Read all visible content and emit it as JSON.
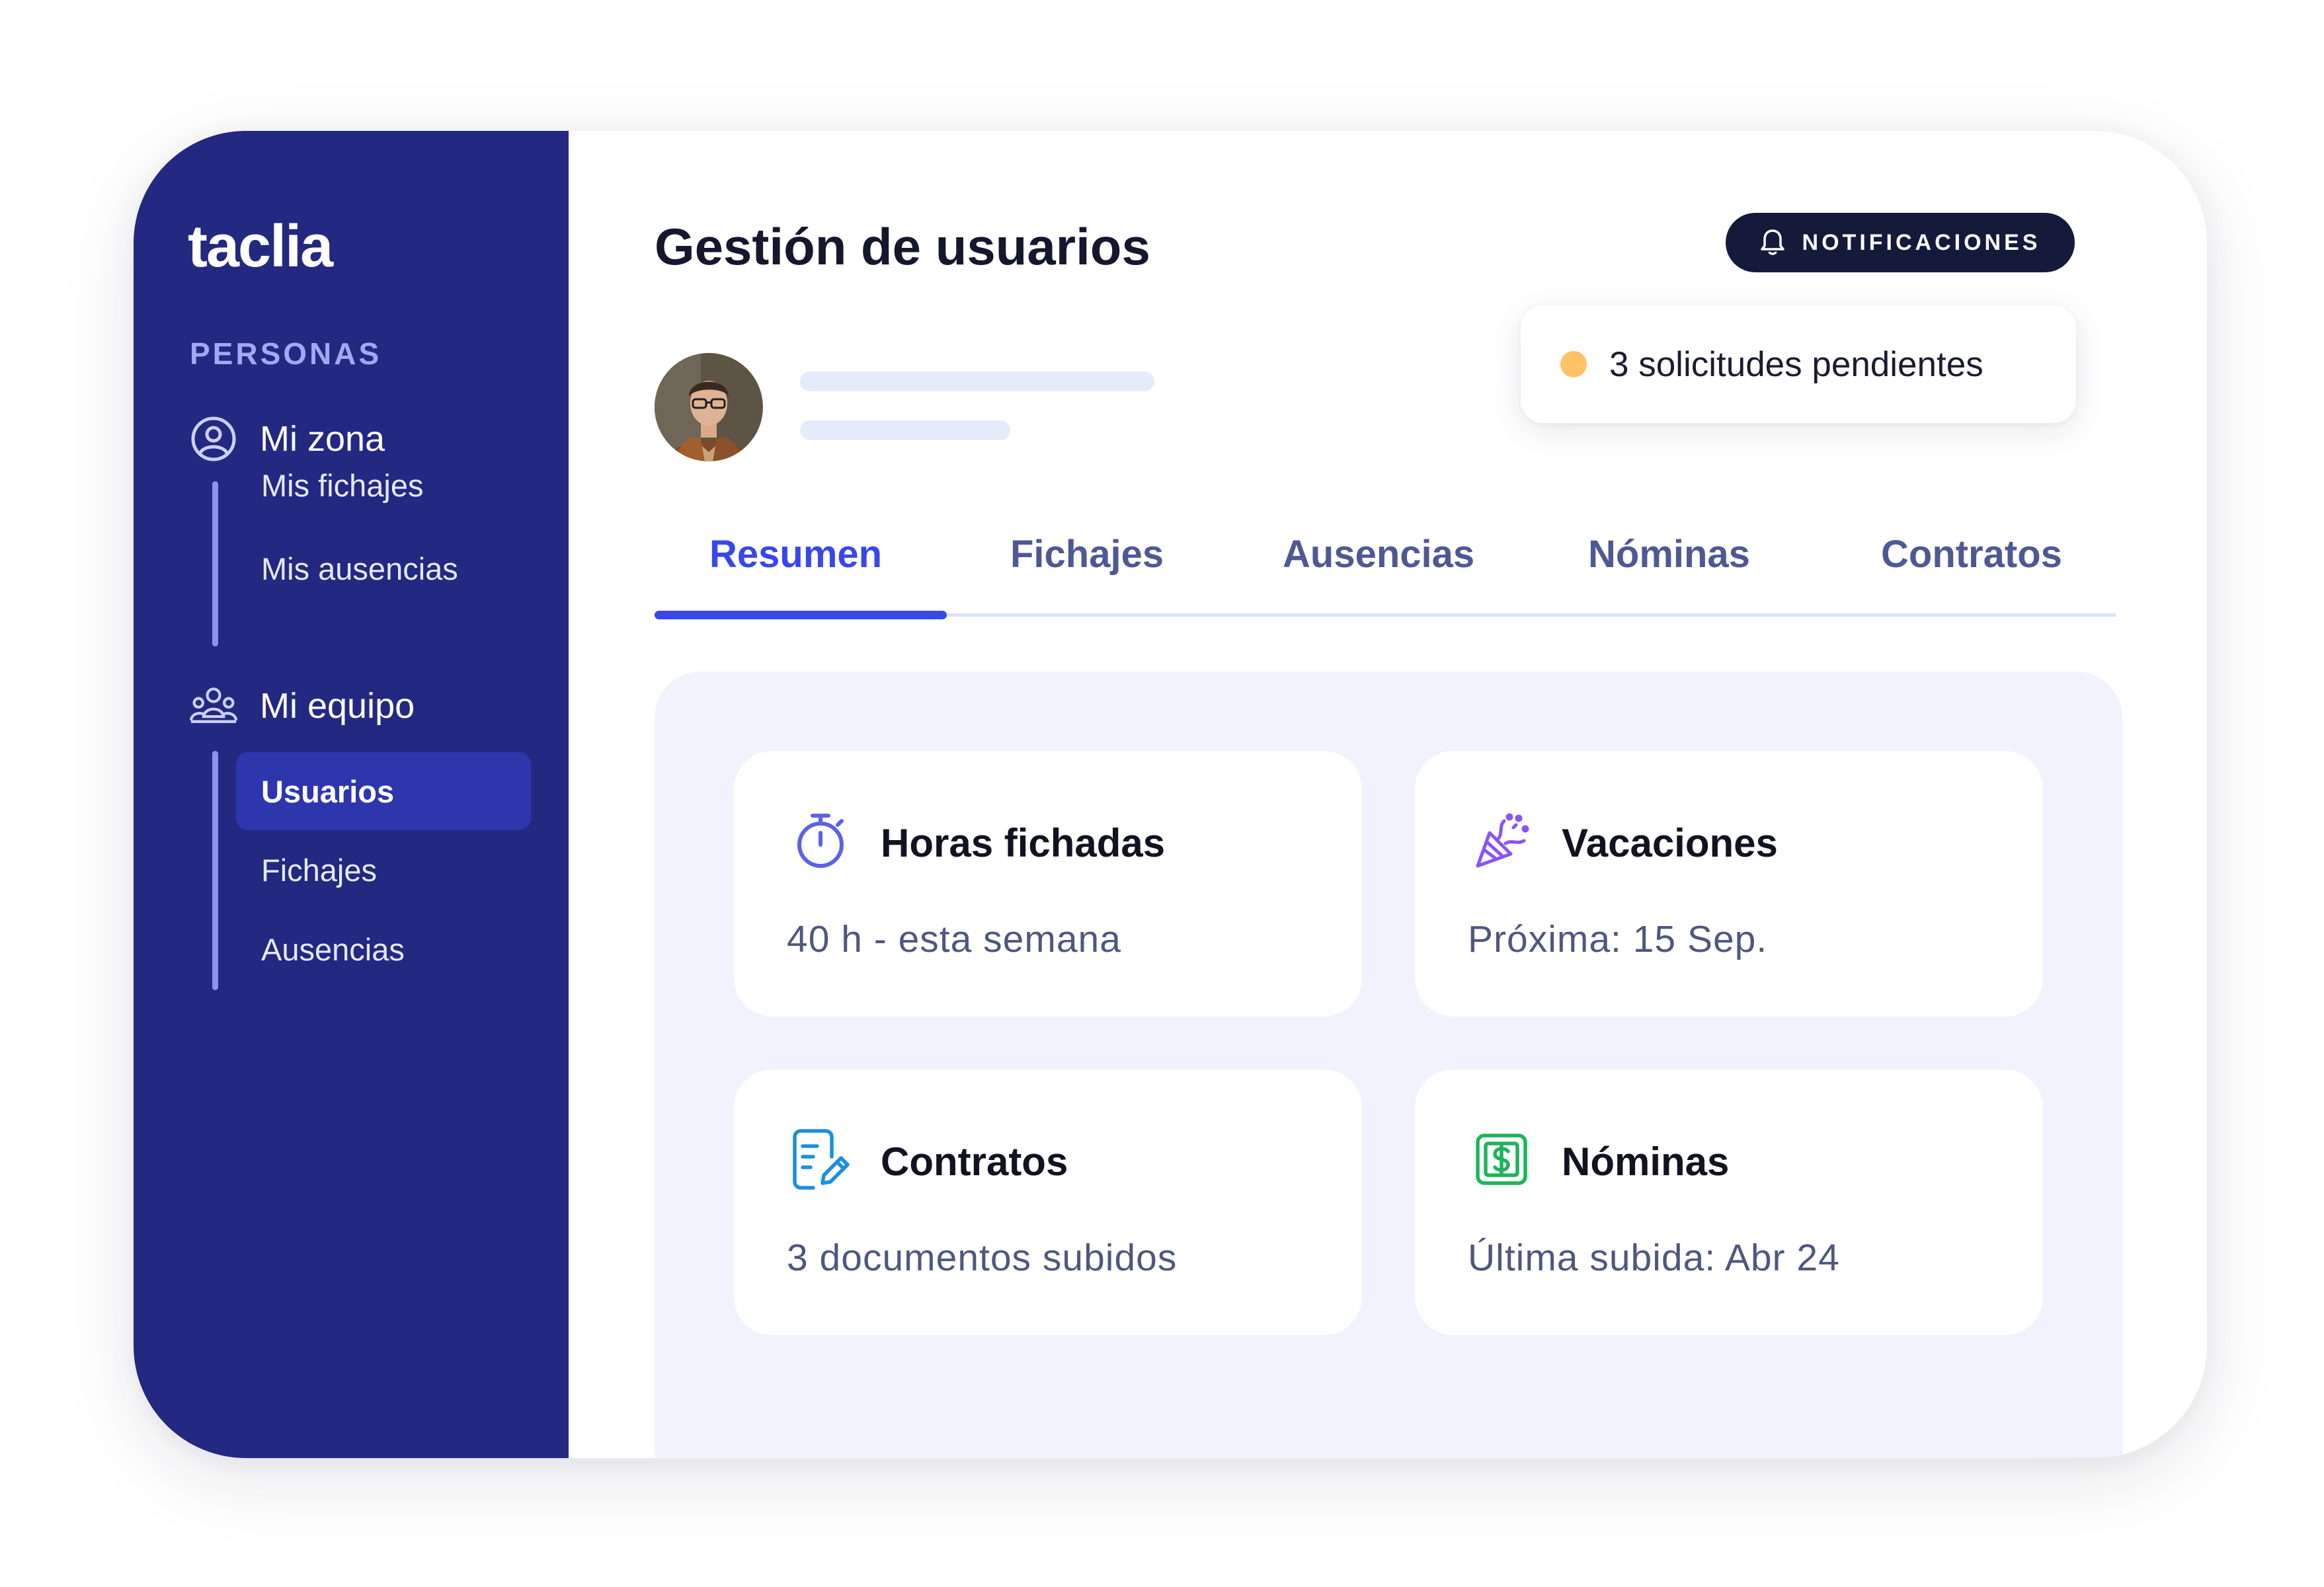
{
  "app": {
    "logo": "taclia",
    "page_title": "Gestión de usuarios"
  },
  "sidebar": {
    "section_label": "PERSONAS",
    "groups": [
      {
        "label": "Mi zona",
        "icon": "user-circle-icon",
        "items": [
          {
            "label": "Mis fichajes",
            "active": false
          },
          {
            "label": "Mis ausencias",
            "active": false
          }
        ]
      },
      {
        "label": "Mi equipo",
        "icon": "team-icon",
        "items": [
          {
            "label": "Usuarios",
            "active": true
          },
          {
            "label": "Fichajes",
            "active": false
          },
          {
            "label": "Ausencias",
            "active": false
          }
        ]
      }
    ]
  },
  "header": {
    "notifications_label": "NOTIFICACIONES",
    "pending_text": "3 solicitudes pendientes",
    "pending_dot_color": "#ffc266"
  },
  "tabs": [
    {
      "label": "Resumen",
      "active": true
    },
    {
      "label": "Fichajes",
      "active": false
    },
    {
      "label": "Ausencias",
      "active": false
    },
    {
      "label": "Nóminas",
      "active": false
    },
    {
      "label": "Contratos",
      "active": false
    }
  ],
  "cards": [
    {
      "title": "Horas fichadas",
      "description": "40 h - esta semana",
      "icon": "stopwatch-icon",
      "icon_color": "#5a63e6"
    },
    {
      "title": "Vacaciones",
      "description": "Próxima: 15 Sep.",
      "icon": "party-popper-icon",
      "icon_color": "#8a54f0"
    },
    {
      "title": "Contratos",
      "description": "3 documentos subidos",
      "icon": "document-edit-icon",
      "icon_color": "#1b8fe0"
    },
    {
      "title": "Nóminas",
      "description": "Última subida: Abr 24",
      "icon": "dollar-bill-icon",
      "icon_color": "#1fb35a"
    }
  ],
  "colors": {
    "sidebar_bg": "#232880",
    "accent": "#3848e8",
    "active_item_bg": "#2e36ad",
    "panel_bg": "#f0f3fe"
  }
}
